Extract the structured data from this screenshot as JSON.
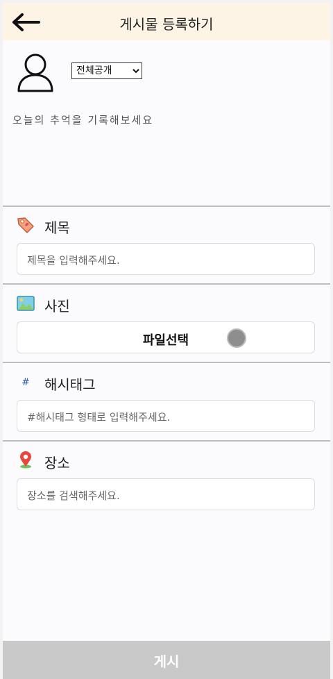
{
  "header": {
    "title": "게시물 등록하기",
    "back_icon": "arrow-left-icon"
  },
  "post": {
    "avatar_icon": "user-icon",
    "visibility": {
      "selected": "전체공개"
    },
    "memo_placeholder": "오늘의 추억을 기록해보세요"
  },
  "sections": {
    "title": {
      "label": "제목",
      "icon": "tag-icon",
      "placeholder": "제목을 입력해주세요."
    },
    "photo": {
      "label": "사진",
      "icon": "image-icon",
      "button_label": "파일선택"
    },
    "hashtag": {
      "label": "해시태그",
      "icon": "hash-icon",
      "icon_text": "#",
      "placeholder": "#해시태그 형태로 입력해주세요."
    },
    "location": {
      "label": "장소",
      "icon": "map-pin-icon",
      "placeholder": "장소를 검색해주세요."
    }
  },
  "submit": {
    "label": "게시"
  },
  "colors": {
    "header_bg": "#fdf4e6",
    "submit_bg": "#c9c9c9",
    "divider": "#bdbdbd"
  }
}
